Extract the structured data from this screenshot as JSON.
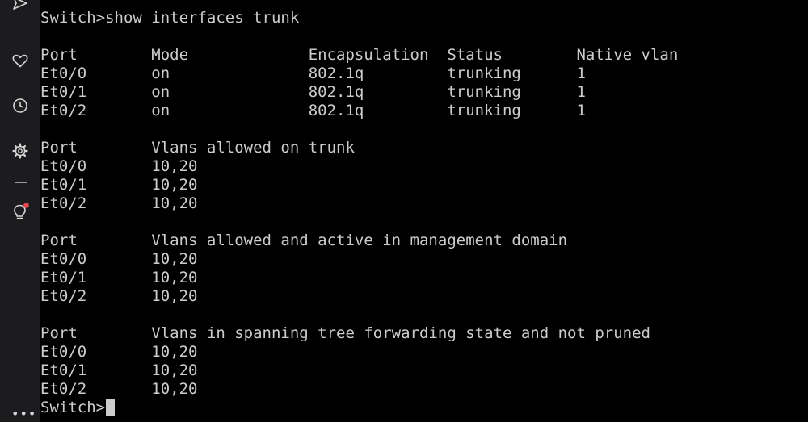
{
  "sidebar": {
    "icons": [
      "send-icon",
      "heart-icon",
      "clock-icon",
      "gear-icon",
      "lightbulb-icon",
      "more-icon"
    ],
    "more_label": "•••",
    "accent_color": "#e5484d"
  },
  "terminal": {
    "lines": [
      "Switch>show interfaces trunk",
      "",
      "Port        Mode             Encapsulation  Status        Native vlan",
      "Et0/0       on               802.1q         trunking      1",
      "Et0/1       on               802.1q         trunking      1",
      "Et0/2       on               802.1q         trunking      1",
      "",
      "Port        Vlans allowed on trunk",
      "Et0/0       10,20",
      "Et0/1       10,20",
      "Et0/2       10,20",
      "",
      "Port        Vlans allowed and active in management domain",
      "Et0/0       10,20",
      "Et0/1       10,20",
      "Et0/2       10,20",
      "",
      "Port        Vlans in spanning tree forwarding state and not pruned",
      "Et0/0       10,20",
      "Et0/1       10,20",
      "Et0/2       10,20"
    ],
    "prompt": "Switch>"
  }
}
